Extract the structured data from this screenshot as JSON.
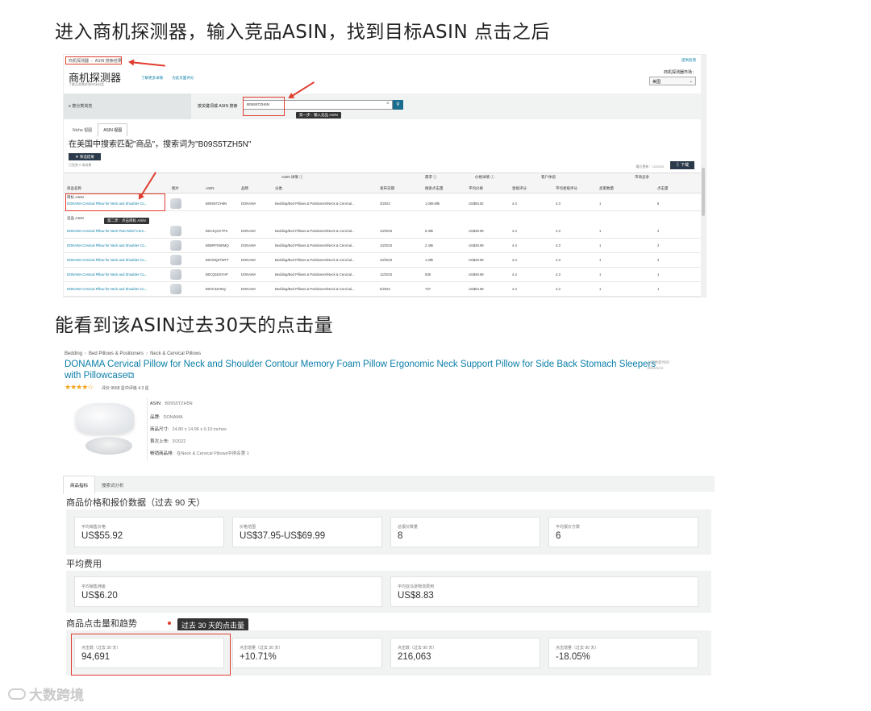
{
  "headings": {
    "h1": "进入商机探测器，输入竞品ASIN，找到目标ASIN 点击之后",
    "h2": "能看到该ASIN过去30天的点击量"
  },
  "shot1": {
    "breadcrumb": [
      "商机探测器",
      "ASIN 搜索结果"
    ],
    "app_title": "商机探测器",
    "app_subtitle": "了解买家需求和市场机会",
    "links": [
      "了解更多详情",
      "为此页面评分"
    ],
    "feedback": "提供反馈",
    "marketplace_label": "商机探测器市场：",
    "marketplace_value": "美国",
    "category_button": "≡ 按分类浏览",
    "search_label": "按关键词或 ASIN 搜索",
    "search_value": "B09S5TZH5N",
    "search_go_icon": "search-icon",
    "tooltip1": "第一步：输入竞品 ASIN",
    "tabs": [
      "Niche 视图",
      "ASIN 视图"
    ],
    "results_title": "在美国中搜索匹配\"商品\"，搜索词为\"B09S5TZH5N\"",
    "filter_button": "▼ 筛选结果",
    "results_count": "已找到 6 条结果",
    "updated": "最后更新：12/2023",
    "download_button": "⇩ 下载",
    "table": {
      "group_headers": [
        "ASIN 详情 ⓘ",
        "需求 ⓘ",
        "价格详情 ⓘ",
        "客户体验",
        "市场竞争"
      ],
      "headers": [
        "商品名称",
        "图片",
        "ASIN",
        "品牌",
        "分类",
        "发布日期",
        "搜索点击量",
        "平均价格",
        "星级评分",
        "平均星级评分",
        "卖家数量",
        "点击量"
      ],
      "row_label_1": "目标 ASIN",
      "row_label_2": "竞品 ASIN",
      "tooltip2": "第二步：点击目标 ASIN",
      "rows": [
        {
          "name": "DONAMA Cervical Pillow for Neck and Shoulder Co...",
          "asin": "B09S5TZH5N",
          "brand": "DONAMA",
          "cat": "Bedding/Bed Pillows & Positioners/Neck & Cervical...",
          "date": "3/2022",
          "clicks": "1,089.69k",
          "price": "US$55.92",
          "stars": "4.4",
          "avg": "4.3",
          "sellers": "1",
          "n": "8"
        },
        {
          "name": "DONAMA Cervical Pillow for Neck Pain Relief Cont...",
          "asin": "B0C4Q1G7PS",
          "brand": "DONAMA",
          "cat": "Bedding/Bed Pillows & Positioners/Neck & Cervical...",
          "date": "10/2023",
          "clicks": "8.39k",
          "price": "US$39.99",
          "stars": "4.4",
          "avg": "4.3",
          "sellers": "1",
          "n": "2"
        },
        {
          "name": "DONAMA Cervical Pillow for Neck and Shoulder Co...",
          "asin": "B0BRPX9DMQ",
          "brand": "DONAMA",
          "cat": "Bedding/Bed Pillows & Positioners/Neck & Cervical...",
          "date": "10/2023",
          "clicks": "2.49k",
          "price": "US$49.99",
          "stars": "4.4",
          "avg": "4.3",
          "sellers": "1",
          "n": "2"
        },
        {
          "name": "DONAMA Cervical Pillow for Neck and Shoulder Co...",
          "asin": "B0CMQ67WFT",
          "brand": "DONAMA",
          "cat": "Bedding/Bed Pillows & Positioners/Neck & Cervical...",
          "date": "10/2023",
          "clicks": "1.09k",
          "price": "US$49.99",
          "stars": "4.4",
          "avg": "4.3",
          "sellers": "1",
          "n": "2"
        },
        {
          "name": "DONAMA Cervical Pillow for Neck and Shoulder Co...",
          "asin": "B0CQ5DSYHF",
          "brand": "DONAMA",
          "cat": "Bedding/Bed Pillows & Positioners/Neck & Cervical...",
          "date": "12/2023",
          "clicks": "838",
          "price": "US$49.99",
          "stars": "4.4",
          "avg": "4.3",
          "sellers": "1",
          "n": "1"
        },
        {
          "name": "DONAMA Cervical Pillow for Neck and Shoulder Co...",
          "asin": "B0CK3ZHKQ",
          "brand": "DONAMA",
          "cat": "Bedding/Bed Pillows & Positioners/Neck & Cervical...",
          "date": "6/2023",
          "clicks": "737",
          "price": "US$53.99",
          "stars": "4.4",
          "avg": "4.3",
          "sellers": "1",
          "n": "1"
        }
      ]
    }
  },
  "shot2": {
    "breadcrumb": [
      "Bedding",
      "Bed Pillows & Positioners",
      "Neck & Cervical Pillows"
    ],
    "title": "DONAMA Cervical Pillow for Neck and Shoulder Contour Memory Foam Pillow Ergonomic Neck Support Pillow for Side Back Stomach Sleepers with Pillowcase⧉",
    "updated": [
      "上次更新时间：",
      "2024/1/14"
    ],
    "stars": "★★★★☆",
    "rating": "评价 9568 星中评级 4.3 星",
    "attributes": [
      {
        "k": "ASIN:",
        "v": "B09S5TZH5N"
      },
      {
        "k": "品牌:",
        "v": "DONAMA"
      },
      {
        "k": "商品尺寸:",
        "v": "24.80 x 14.96 x 0.10 inches"
      },
      {
        "k": "首次上市:",
        "v": "3/2022"
      },
      {
        "k": "畅销商品排:",
        "v": "在Neck & Cervical Pillows中排名第 1"
      }
    ],
    "tabs": [
      "商品指标",
      "搜索词分析"
    ],
    "sec1_title": "商品价格和报价数据（过去 90 天）",
    "sec1_cards": [
      {
        "label": "平均销售价格",
        "value": "US$55.92"
      },
      {
        "label": "价格范围",
        "value": "US$37.95-US$69.99"
      },
      {
        "label": "总报价数量",
        "value": "8"
      },
      {
        "label": "平均报价方数",
        "value": "6"
      }
    ],
    "sec2_title": "平均费用",
    "sec2_cards": [
      {
        "label": "平均销售佣金",
        "value": "US$6.20"
      },
      {
        "label": "平均亚马逊物流费用",
        "value": "US$8.83"
      }
    ],
    "sec3_title": "商品点击量和趋势",
    "tooltip": "过去 30 天的点击量",
    "sec3_cards": [
      {
        "label": "点击数（过去 30 天）",
        "value": "94,691"
      },
      {
        "label": "点击增量（过去 30 天）",
        "value": "+10.71%"
      },
      {
        "label": "点击数（过去 90 天）",
        "value": "216,063"
      },
      {
        "label": "点击增量（过去 90 天）",
        "value": "-18.05%"
      }
    ]
  },
  "watermark": "大数跨境",
  "colors": {
    "annotation_red": "#e03c2e",
    "link_blue": "#0a7ea8",
    "dark_button": "#2b3a4a"
  }
}
